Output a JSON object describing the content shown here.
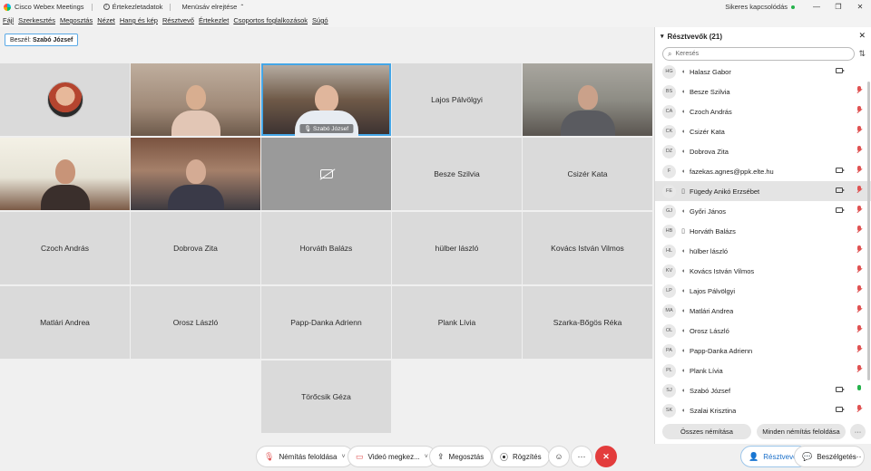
{
  "titlebar": {
    "app_name": "Cisco Webex Meetings",
    "meeting_info": "Értekezletadatok",
    "hide_menu": "Menüsáv elrejtése",
    "status": "Sikeres kapcsolódás"
  },
  "menu": [
    "Fájl",
    "Szerkesztés",
    "Megosztás",
    "Nézet",
    "Hang és kép",
    "Résztvevő",
    "Értekezlet",
    "Csoportos foglalkozások",
    "Súgó"
  ],
  "speaker": {
    "label": "Beszél:",
    "name": "Szabó József"
  },
  "grid": {
    "tiles": [
      {
        "type": "avatar",
        "name": ""
      },
      {
        "type": "video",
        "name": ""
      },
      {
        "type": "video-active",
        "name": "Szabó József"
      },
      {
        "type": "name",
        "name": "Lajos Pálvölgyi"
      },
      {
        "type": "video",
        "name": ""
      },
      {
        "type": "video",
        "name": ""
      },
      {
        "type": "video",
        "name": ""
      },
      {
        "type": "camoff",
        "name": ""
      },
      {
        "type": "name",
        "name": "Besze Szilvia"
      },
      {
        "type": "name",
        "name": "Csizér Kata"
      },
      {
        "type": "name",
        "name": "Czoch András"
      },
      {
        "type": "name",
        "name": "Dobrova Zita"
      },
      {
        "type": "name",
        "name": "Horváth Balázs"
      },
      {
        "type": "name",
        "name": "hülber lászló"
      },
      {
        "type": "name",
        "name": "Kovács István Vilmos"
      },
      {
        "type": "name",
        "name": "Matlári Andrea"
      },
      {
        "type": "name",
        "name": "Orosz László"
      },
      {
        "type": "name",
        "name": "Papp-Danka Adrienn"
      },
      {
        "type": "name",
        "name": "Plank Lívia"
      },
      {
        "type": "name",
        "name": "Szarka-Bőgös Réka"
      },
      {
        "type": "name",
        "name": "Törőcsik Géza"
      }
    ]
  },
  "toolbar": {
    "unmute": "Némítás feloldása",
    "video": "Videó megkez...",
    "share": "Megosztás",
    "record": "Rögzítés",
    "participants": "Résztvevők",
    "chat": "Beszélgetés"
  },
  "panel": {
    "title": "Résztvevők (21)",
    "search_placeholder": "Keresés",
    "mute_all": "Összes némítása",
    "unmute_all": "Minden némítás feloldása",
    "participants": [
      {
        "initials": "HG",
        "device": "audio",
        "name": "Halasz Gabor",
        "cam": true,
        "mic": "none"
      },
      {
        "initials": "BS",
        "device": "audio",
        "name": "Besze Szilvia",
        "cam": false,
        "mic": "muted"
      },
      {
        "initials": "CA",
        "device": "audio",
        "name": "Czoch András",
        "cam": false,
        "mic": "muted"
      },
      {
        "initials": "CK",
        "device": "audio",
        "name": "Csizér Kata",
        "cam": false,
        "mic": "muted"
      },
      {
        "initials": "DZ",
        "device": "audio",
        "name": "Dobrova Zita",
        "cam": false,
        "mic": "muted"
      },
      {
        "initials": "F",
        "device": "audio",
        "name": "fazekas.agnes@ppk.elte.hu",
        "cam": true,
        "mic": "muted"
      },
      {
        "initials": "FE",
        "device": "phone",
        "name": "Fügedy Anikó Erzsébet",
        "cam": true,
        "mic": "muted"
      },
      {
        "initials": "GJ",
        "device": "audio",
        "name": "Győri János",
        "cam": true,
        "mic": "muted"
      },
      {
        "initials": "HB",
        "device": "phone",
        "name": "Horváth Balázs",
        "cam": false,
        "mic": "muted"
      },
      {
        "initials": "HL",
        "device": "audio",
        "name": "hülber lászló",
        "cam": false,
        "mic": "muted"
      },
      {
        "initials": "KV",
        "device": "audio",
        "name": "Kovács István Vilmos",
        "cam": false,
        "mic": "muted"
      },
      {
        "initials": "LP",
        "device": "audio",
        "name": "Lajos Pálvölgyi",
        "cam": false,
        "mic": "muted"
      },
      {
        "initials": "MA",
        "device": "audio",
        "name": "Matlári Andrea",
        "cam": false,
        "mic": "muted"
      },
      {
        "initials": "OL",
        "device": "audio",
        "name": "Orosz László",
        "cam": false,
        "mic": "muted"
      },
      {
        "initials": "PA",
        "device": "audio",
        "name": "Papp-Danka Adrienn",
        "cam": false,
        "mic": "muted"
      },
      {
        "initials": "PL",
        "device": "audio",
        "name": "Plank Lívia",
        "cam": false,
        "mic": "muted"
      },
      {
        "initials": "SJ",
        "device": "audio",
        "name": "Szabó József",
        "cam": true,
        "mic": "on"
      },
      {
        "initials": "SK",
        "device": "audio",
        "name": "Szalai Krisztina",
        "cam": true,
        "mic": "muted"
      }
    ]
  }
}
